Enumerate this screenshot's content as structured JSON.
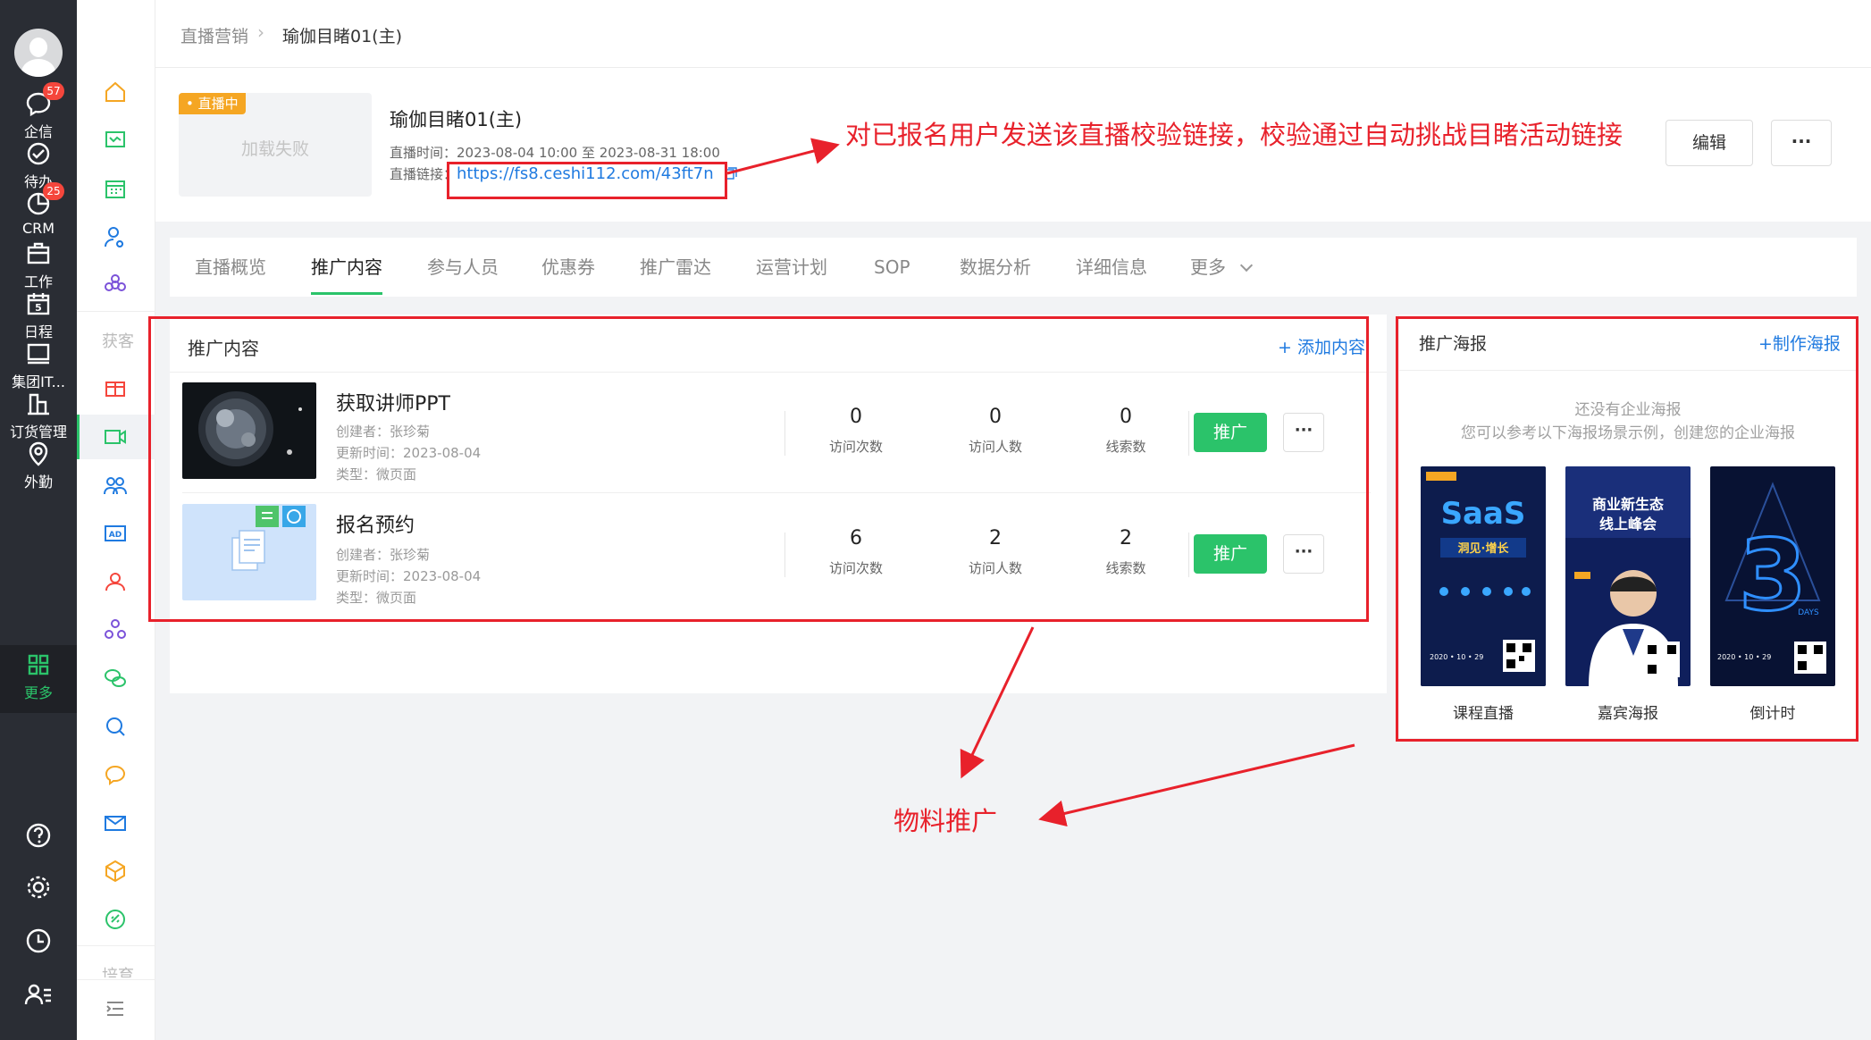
{
  "colors": {
    "accent_green": "#2bc36a",
    "link_blue": "#1f7ae0",
    "annotation_red": "#e8212b",
    "rail_bg": "#2a2d34",
    "live_orange": "#f5a623"
  },
  "rail": {
    "items": [
      {
        "label": "企信",
        "icon": "chat-bubble-icon",
        "badge": "57"
      },
      {
        "label": "待办",
        "icon": "check-circle-icon",
        "badge": ""
      },
      {
        "label": "CRM",
        "icon": "pie-chart-icon",
        "badge": "25"
      },
      {
        "label": "工作",
        "icon": "briefcase-icon",
        "badge": ""
      },
      {
        "label": "日程",
        "icon": "calendar-icon",
        "badge": ""
      },
      {
        "label": "集团IT...",
        "icon": "monitor-icon",
        "badge": ""
      },
      {
        "label": "订货管理",
        "icon": "bar-chart-icon",
        "badge": ""
      },
      {
        "label": "外勤",
        "icon": "location-pin-icon",
        "badge": ""
      },
      {
        "label": "更多",
        "icon": "grid-icon",
        "badge": ""
      }
    ],
    "bottom_icons": [
      "help-icon",
      "settings-icon",
      "clock-icon",
      "user-list-icon"
    ]
  },
  "nav2": {
    "section_acquire": "获客",
    "section_nurture": "培育"
  },
  "breadcrumb": {
    "parent": "直播营销",
    "current": "瑜伽目睹01(主)"
  },
  "live": {
    "status_tag": "直播中",
    "cover_placeholder": "加载失败",
    "title": "瑜伽目睹01(主)",
    "time_label": "直播时间：",
    "time_value": "2023-08-04 10:00 至 2023-08-31 18:00",
    "link_label": "直播链接：",
    "link_url": "https://fs8.ceshi112.com/43ft7n",
    "edit_button": "编辑",
    "more_button": "···"
  },
  "tabs": [
    "直播概览",
    "推广内容",
    "参与人员",
    "优惠券",
    "推广雷达",
    "运营计划",
    "SOP",
    "数据分析",
    "详细信息",
    "更多"
  ],
  "active_tab": "推广内容",
  "promo": {
    "title": "推广内容",
    "add_label": "+ 添加内容",
    "promote_button": "推广",
    "dots_button": "···",
    "stat_labels": [
      "访问次数",
      "访问人数",
      "线索数"
    ],
    "items": [
      {
        "name": "获取讲师PPT",
        "creator": "创建者：张珍菊",
        "updated": "更新时间：2023-08-04",
        "type": "类型：微页面",
        "visits": "0",
        "visitors": "0",
        "leads": "0"
      },
      {
        "name": "报名预约",
        "creator": "创建者：张珍菊",
        "updated": "更新时间：2023-08-04",
        "type": "类型：微页面",
        "visits": "6",
        "visitors": "2",
        "leads": "2"
      }
    ]
  },
  "posters": {
    "title": "推广海报",
    "make_label": "+制作海报",
    "empty_line1": "还没有企业海报",
    "empty_line2": "您可以参考以下海报场景示例，创建您的企业海报",
    "samples": [
      {
        "caption": "课程直播",
        "headline": "SaaS",
        "sub": "洞见·增长",
        "date": "2020 • 10 • 29"
      },
      {
        "caption": "嘉宾海报",
        "headline": "商业新生态",
        "sub": "线上峰会",
        "date": ""
      },
      {
        "caption": "倒计时",
        "headline": "3",
        "sub": "DAYS",
        "date": "2020 • 10 • 29"
      }
    ]
  },
  "annotations": {
    "link_note": "对已报名用户发送该直播校验链接，校验通过自动挑战目睹活动链接",
    "material_note": "物料推广"
  }
}
